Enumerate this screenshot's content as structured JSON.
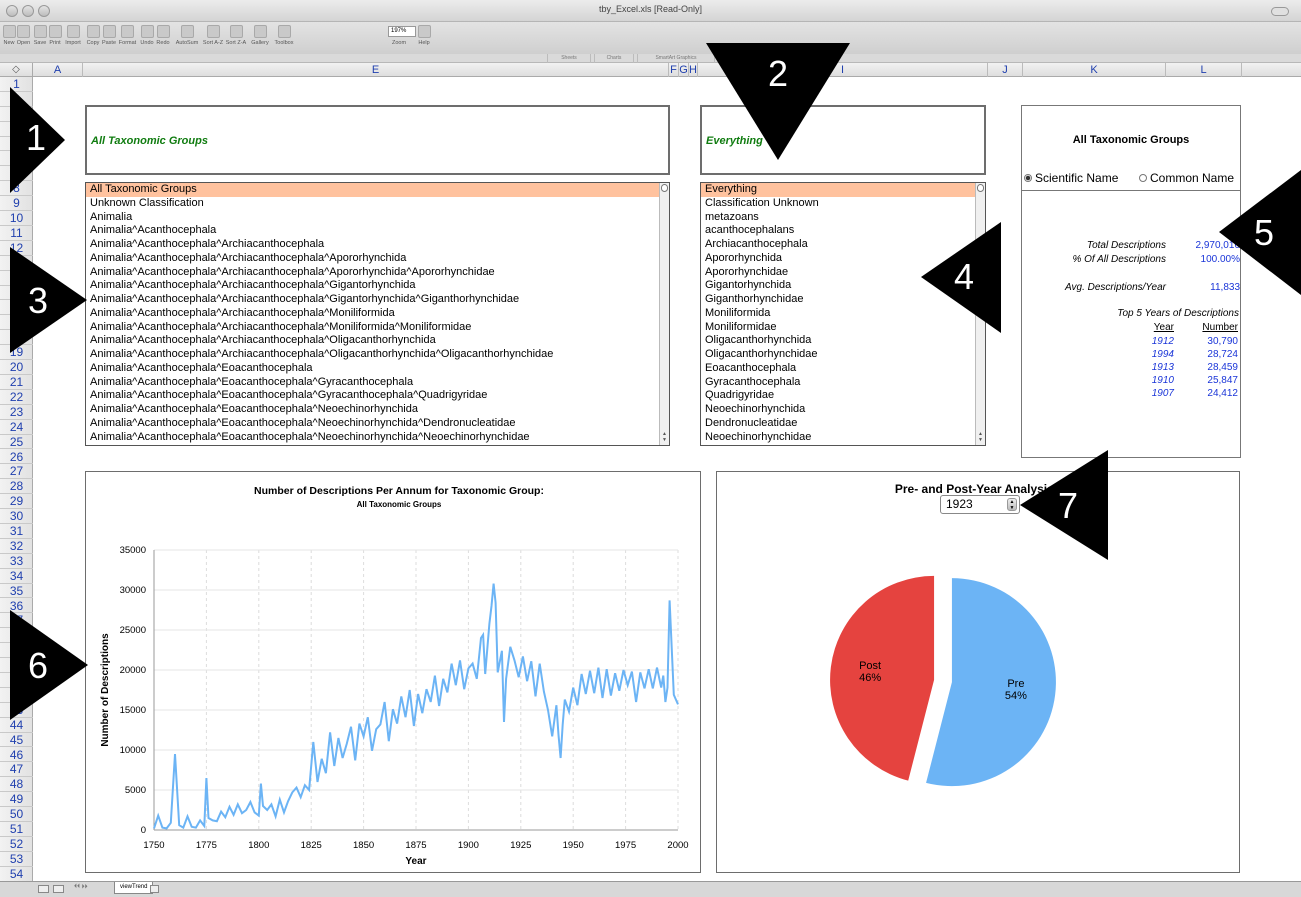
{
  "window": {
    "title": "tby_Excel.xls  [Read-Only]"
  },
  "toolbar": {
    "items": [
      "New",
      "Open",
      "Save",
      "Print",
      "Import",
      "Copy",
      "Paste",
      "Format",
      "Undo",
      "Redo",
      "AutoSum",
      "Sort A-Z",
      "Sort Z-A",
      "Gallery",
      "Toolbox",
      "Zoom",
      "Help"
    ],
    "zoom": "197%",
    "ribbon_tabs": [
      "Sheets",
      "Charts",
      "SmartArt Graphics"
    ]
  },
  "columns": [
    "A",
    "E",
    "F",
    "G",
    "H",
    "I",
    "J",
    "K",
    "L"
  ],
  "rows": [
    "1",
    "2",
    "3",
    "4",
    "5",
    "6",
    "7",
    "8",
    "9",
    "10",
    "11",
    "12",
    "13",
    "14",
    "15",
    "16",
    "17",
    "18",
    "19",
    "20",
    "21",
    "22",
    "23",
    "24",
    "25",
    "26",
    "27",
    "28",
    "29",
    "30",
    "31",
    "32",
    "33",
    "34",
    "35",
    "36",
    "37",
    "38",
    "39",
    "40",
    "41",
    "42",
    "43",
    "44",
    "45",
    "46",
    "47",
    "48",
    "49",
    "50",
    "51",
    "52",
    "53",
    "54"
  ],
  "group_header": {
    "text": "All Taxonomic Groups"
  },
  "common_header": {
    "text": "Everything"
  },
  "scientific_list": [
    "All Taxonomic Groups",
    "Unknown Classification",
    "Animalia",
    "Animalia^Acanthocephala",
    "Animalia^Acanthocephala^Archiacanthocephala",
    "Animalia^Acanthocephala^Archiacanthocephala^Apororhynchida",
    "Animalia^Acanthocephala^Archiacanthocephala^Apororhynchida^Apororhynchidae",
    "Animalia^Acanthocephala^Archiacanthocephala^Gigantorhynchida",
    "Animalia^Acanthocephala^Archiacanthocephala^Gigantorhynchida^Giganthorhynchidae",
    "Animalia^Acanthocephala^Archiacanthocephala^Moniliformida",
    "Animalia^Acanthocephala^Archiacanthocephala^Moniliformida^Moniliformidae",
    "Animalia^Acanthocephala^Archiacanthocephala^Oligacanthorhynchida",
    "Animalia^Acanthocephala^Archiacanthocephala^Oligacanthorhynchida^Oligacanthorhynchidae",
    "Animalia^Acanthocephala^Eoacanthocephala",
    "Animalia^Acanthocephala^Eoacanthocephala^Gyracanthocephala",
    "Animalia^Acanthocephala^Eoacanthocephala^Gyracanthocephala^Quadrigyridae",
    "Animalia^Acanthocephala^Eoacanthocephala^Neoechinorhynchida",
    "Animalia^Acanthocephala^Eoacanthocephala^Neoechinorhynchida^Dendronucleatidae",
    "Animalia^Acanthocephala^Eoacanthocephala^Neoechinorhynchida^Neoechinorhynchidae"
  ],
  "common_list": [
    "Everything",
    "Classification Unknown",
    "metazoans",
    "acanthocephalans",
    "Archiacanthocephala",
    "Apororhynchida",
    "Apororhynchidae",
    "Gigantorhynchida",
    "Giganthorhynchidae",
    "Moniliformida",
    "Moniliformidae",
    "Oligacanthorhynchida",
    "Oligacanthorhynchidae",
    "Eoacanthocephala",
    "Gyracanthocephala",
    "Quadrigyridae",
    "Neoechinorhynchida",
    "Dendronucleatidae",
    "Neoechinorhynchidae"
  ],
  "stats": {
    "title": "All Taxonomic Groups",
    "radio_scientific": "Scientific Name",
    "radio_common": "Common Name",
    "total_label": "Total Descriptions",
    "total_value": "2,970,016",
    "pct_label": "% Of All Descriptions",
    "pct_value": "100.00%",
    "avg_label": "Avg. Descriptions/Year",
    "avg_value": "11,833",
    "top5_label": "Top 5 Years of Descriptions",
    "year_header": "Year",
    "number_header": "Number",
    "top5": [
      {
        "year": "1912",
        "number": "30,790"
      },
      {
        "year": "1994",
        "number": "28,724"
      },
      {
        "year": "1913",
        "number": "28,459"
      },
      {
        "year": "1910",
        "number": "25,847"
      },
      {
        "year": "1907",
        "number": "24,412"
      }
    ]
  },
  "pie_panel": {
    "title": "Pre- and Post-Year Analysis f",
    "year": "1923"
  },
  "sheet": {
    "tab": "viewTrend"
  },
  "callouts": [
    "1",
    "2",
    "3",
    "4",
    "5",
    "6",
    "7"
  ],
  "chart_data": [
    {
      "type": "line",
      "title": "Number of Descriptions Per Annum for Taxonomic Group:",
      "subtitle": "All Taxonomic Groups",
      "xlabel": "Year",
      "ylabel": "Number of Descriptions",
      "xlim": [
        1750,
        2000
      ],
      "ylim": [
        0,
        35000
      ],
      "xticks": [
        "1750",
        "1775",
        "1800",
        "1825",
        "1850",
        "1875",
        "1900",
        "1925",
        "1950",
        "1975",
        "2000"
      ],
      "yticks": [
        "0",
        "5000",
        "10000",
        "15000",
        "20000",
        "25000",
        "30000",
        "35000"
      ],
      "grid": true,
      "color": "#6cb4f5",
      "x": [
        1750,
        1752,
        1754,
        1756,
        1758,
        1760,
        1762,
        1764,
        1766,
        1768,
        1770,
        1772,
        1774,
        1775,
        1776,
        1778,
        1780,
        1782,
        1784,
        1786,
        1788,
        1790,
        1792,
        1794,
        1796,
        1798,
        1800,
        1801,
        1802,
        1804,
        1806,
        1808,
        1810,
        1812,
        1814,
        1816,
        1818,
        1820,
        1822,
        1824,
        1826,
        1828,
        1830,
        1832,
        1834,
        1836,
        1838,
        1840,
        1842,
        1844,
        1846,
        1848,
        1850,
        1852,
        1854,
        1856,
        1858,
        1860,
        1862,
        1864,
        1866,
        1868,
        1870,
        1872,
        1874,
        1876,
        1878,
        1880,
        1882,
        1884,
        1886,
        1888,
        1890,
        1892,
        1894,
        1896,
        1898,
        1900,
        1902,
        1904,
        1906,
        1907,
        1908,
        1910,
        1911,
        1912,
        1913,
        1914,
        1916,
        1917,
        1918,
        1920,
        1922,
        1924,
        1926,
        1928,
        1930,
        1932,
        1934,
        1936,
        1938,
        1940,
        1942,
        1943,
        1944,
        1945,
        1946,
        1948,
        1950,
        1952,
        1954,
        1956,
        1958,
        1960,
        1962,
        1964,
        1966,
        1968,
        1970,
        1972,
        1974,
        1976,
        1978,
        1980,
        1982,
        1984,
        1986,
        1988,
        1990,
        1992,
        1993,
        1994,
        1995,
        1996,
        1998,
        2000
      ],
      "values": [
        200,
        1800,
        300,
        200,
        900,
        9500,
        600,
        300,
        1700,
        400,
        300,
        1200,
        500,
        6500,
        1500,
        1200,
        1100,
        2300,
        1600,
        2900,
        1900,
        3200,
        2100,
        2500,
        3500,
        2200,
        1800,
        5800,
        3000,
        2500,
        3200,
        1700,
        3800,
        2200,
        3600,
        4700,
        5300,
        4100,
        5600,
        5000,
        11000,
        6000,
        8900,
        7100,
        12200,
        8000,
        11500,
        9000,
        10800,
        12900,
        8700,
        13300,
        11700,
        14100,
        9900,
        12600,
        13200,
        16000,
        11100,
        15100,
        13300,
        16700,
        14100,
        17500,
        13000,
        17000,
        14600,
        17600,
        16000,
        19300,
        15500,
        18900,
        17200,
        20800,
        18100,
        21200,
        17600,
        20200,
        20800,
        18900,
        24000,
        24400,
        19500,
        25800,
        28000,
        30800,
        28400,
        19700,
        22400,
        13500,
        18900,
        22900,
        21200,
        19100,
        21700,
        18600,
        21100,
        16700,
        20800,
        17300,
        15000,
        11700,
        15600,
        11900,
        9000,
        13200,
        16300,
        14800,
        17800,
        15600,
        19500,
        17000,
        19900,
        17100,
        20300,
        16500,
        20100,
        16800,
        19600,
        17400,
        20000,
        18100,
        19800,
        16000,
        19700,
        17700,
        20100,
        17700,
        20300,
        17800,
        19300,
        16000,
        17800,
        28700,
        16900,
        15700,
        14300
      ]
    },
    {
      "type": "pie",
      "categories": [
        "Pre",
        "Post"
      ],
      "values": [
        54,
        46
      ],
      "labels": [
        "Pre\n54%",
        "Post\n46%"
      ],
      "colors": [
        "#6cb4f5",
        "#e5433f"
      ]
    }
  ]
}
